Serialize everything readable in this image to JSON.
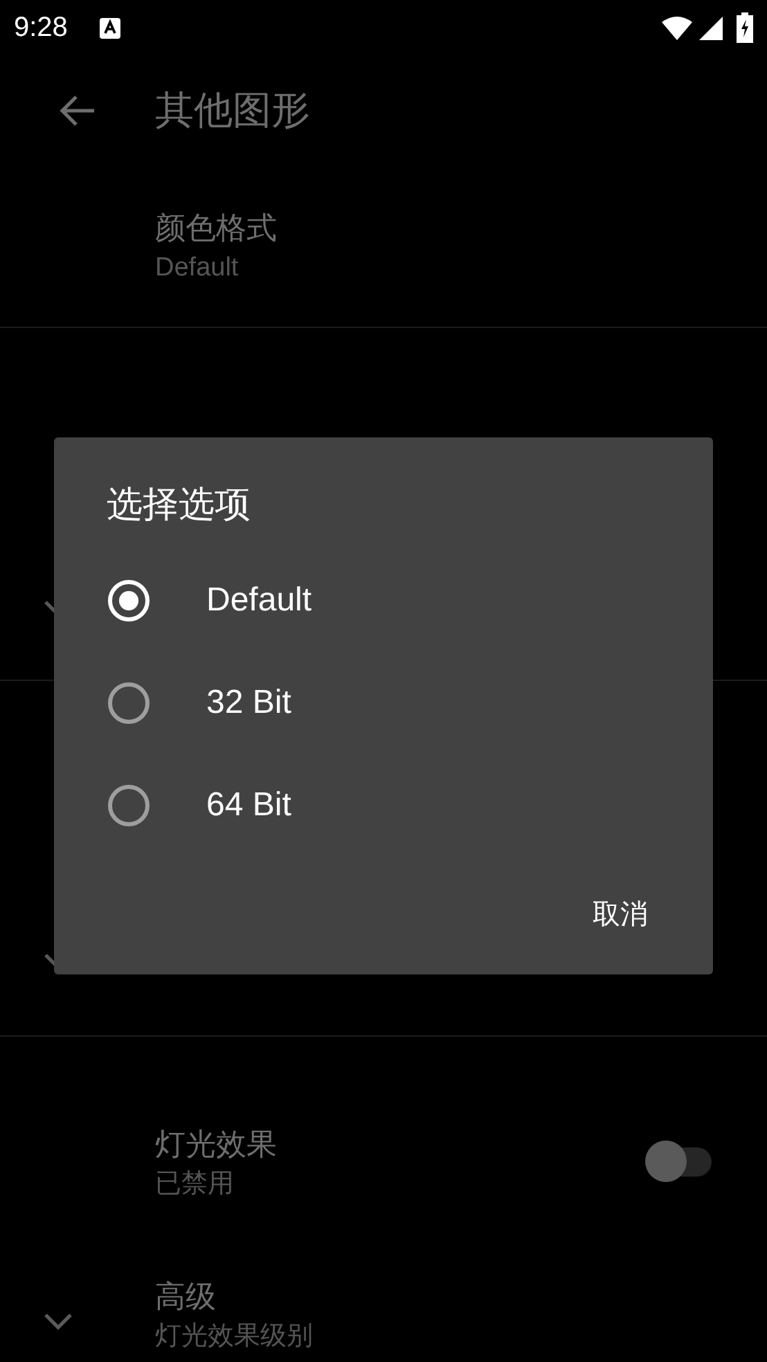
{
  "status_bar": {
    "time": "9:28"
  },
  "toolbar": {
    "title": "其他图形"
  },
  "settings": [
    {
      "kind": "text",
      "title": "颜色格式",
      "summary": "Default"
    },
    {
      "kind": "expandable"
    },
    {
      "kind": "expandable"
    },
    {
      "kind": "switch",
      "title": "灯光效果",
      "summary": "已禁用",
      "on": false
    },
    {
      "kind": "expandable",
      "title": "高级",
      "summary": "灯光效果级别"
    }
  ],
  "dialog": {
    "title": "选择选项",
    "options": [
      {
        "label": "Default",
        "selected": true
      },
      {
        "label": "32 Bit",
        "selected": false
      },
      {
        "label": "64 Bit",
        "selected": false
      }
    ],
    "buttons": [
      "取消"
    ]
  }
}
